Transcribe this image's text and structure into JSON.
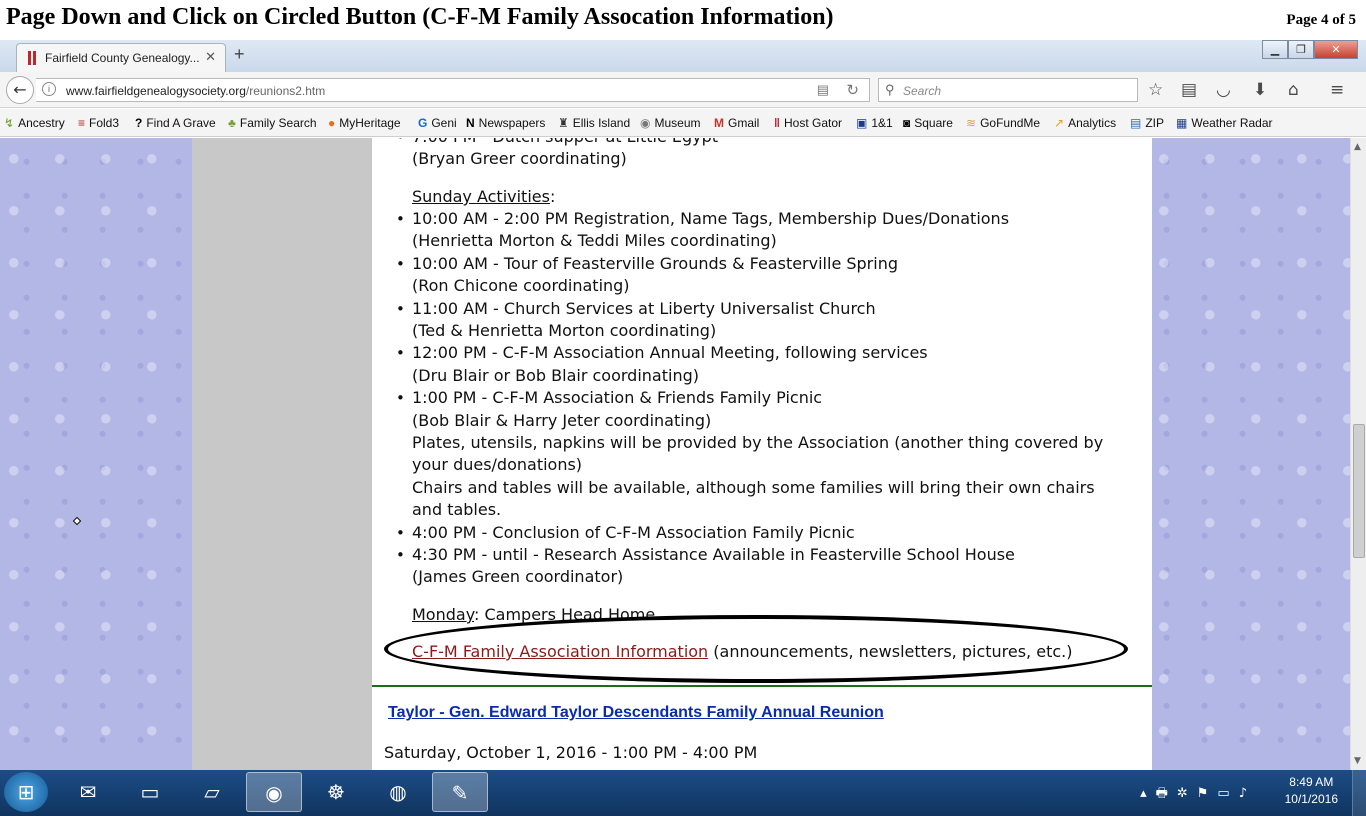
{
  "document": {
    "title": "Page Down and Click on Circled Button (C-F-M Family Assocation Information)",
    "page": "Page 4 of 5"
  },
  "browser": {
    "tab_title": "Fairfield County Genealogy...",
    "url_domain": "www.fairfieldgenealogysociety.org",
    "url_path": "/reunions2.htm",
    "search_placeholder": "Search",
    "bookmarks": [
      "Ancestry",
      "Fold3",
      "Find A Grave",
      "Family Search",
      "MyHeritage",
      "Geni",
      "Newspapers",
      "Ellis Island",
      "Museum",
      "Gmail",
      "Host Gator",
      "1&1",
      "Square",
      "GoFundMe",
      "Analytics",
      "ZIP",
      "Weather Radar"
    ]
  },
  "page": {
    "top_partial": "7:00 PM - Dutch supper at Little Egypt",
    "top_coord": "(Bryan Greer coordinating)",
    "sunday_heading": "Sunday Activities",
    "sunday_colon": ":",
    "items": [
      {
        "line": "10:00 AM - 2:00 PM Registration, Name Tags, Membership Dues/Donations",
        "sub": "(Henrietta Morton & Teddi Miles coordinating)"
      },
      {
        "line": "10:00 AM - Tour of Feasterville Grounds & Feasterville Spring",
        "sub": "(Ron Chicone coordinating)"
      },
      {
        "line": "11:00 AM - Church Services at Liberty Universalist Church",
        "sub": "(Ted & Henrietta Morton coordinating)"
      },
      {
        "line": "12:00 PM - C-F-M Association Annual Meeting, following services",
        "sub": "(Dru Blair or Bob Blair coordinating)"
      },
      {
        "line": "1:00 PM - C-F-M Association & Friends Family Picnic",
        "sub": "(Bob Blair & Harry Jeter coordinating)"
      }
    ],
    "picnic_notes": [
      "Plates, utensils, napkins will be provided by the Association (another thing covered by",
      "your dues/donations)",
      "Chairs and tables will be available, although some families will bring their own chairs",
      "and tables."
    ],
    "item_conclusion": "4:00 PM - Conclusion of C-F-M Association Family Picnic",
    "item_research": "4:30 PM - until - Research Assistance Available in Feasterville School House",
    "research_coord": "(James Green coordinator)",
    "monday_heading": "Monday",
    "monday_text": ": Campers Head Home",
    "cfm_link": "C-F-M Family Association Information",
    "cfm_suffix": " (announcements, newsletters, pictures, etc.)",
    "taylor_link": "Taylor - Gen. Edward Taylor Descendants Family Annual Reunion",
    "taylor_date": "Saturday, October 1, 2016 - 1:00 PM - 4:00 PM"
  },
  "taskbar": {
    "time": "8:49 AM",
    "date": "10/1/2016"
  },
  "colors": {
    "link_visited": "#8b1a1a",
    "link": "#0a2ab0",
    "divider": "#1a6e1a",
    "side_background": "#b3b7e6"
  }
}
